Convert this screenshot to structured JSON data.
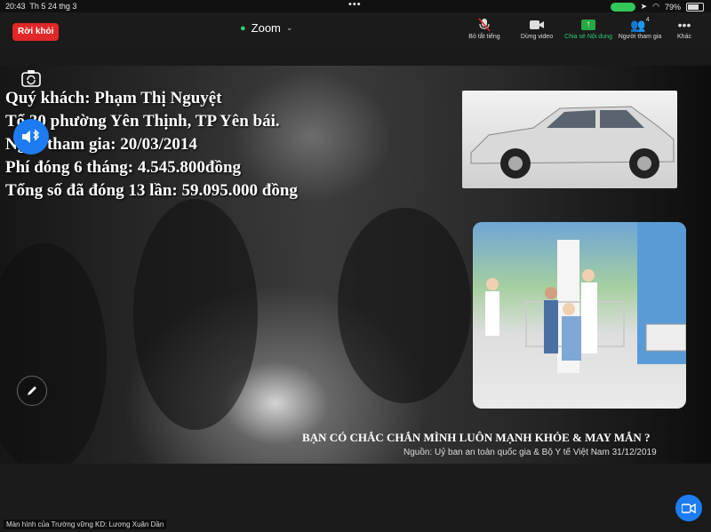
{
  "status_bar": {
    "time": "20:43",
    "date": "Th 5 24 thg 3",
    "battery": "79%",
    "dots": "•••"
  },
  "toolbar": {
    "leave_label": "Rời khỏi",
    "title": "Zoom",
    "mute_label": "Bỏ tắt tiếng",
    "stop_video_label": "Dừng video",
    "share_label": "Chia sẻ Nội dung",
    "participants_label": "Người tham gia",
    "participants_count": "4",
    "more_label": "Khác",
    "accent_color": "#2ecc71",
    "leave_color": "#e02828"
  },
  "slide": {
    "lines": [
      "Quý khách: Phạm Thị Nguyệt",
      "Tổ 30 phường Yên Thịnh, TP Yên bái.",
      "Ngày tham gia: 20/03/2014",
      "Phí đóng 6 tháng: 4.545.800đồng",
      "Tổng số đã đóng 13 lần: 59.095.000 đồng"
    ],
    "caption": "BẠN CÓ CHẮC CHẮN MÌNH LUÔN MẠNH KHỎE & MAY MẮN ?",
    "source": "Nguồn: Uỷ ban an toàn quốc gia & Bộ Y tế Việt Nam 31/12/2019"
  },
  "footer": {
    "name_label": "Màn hình của Trường vững KD: Lương Xuân Dần"
  },
  "icons": [
    "camera-flip-icon",
    "bluetooth-audio-icon",
    "pencil-icon",
    "video-icon",
    "mute-mic-icon",
    "participants-icon",
    "more-icon",
    "shield-icon"
  ]
}
